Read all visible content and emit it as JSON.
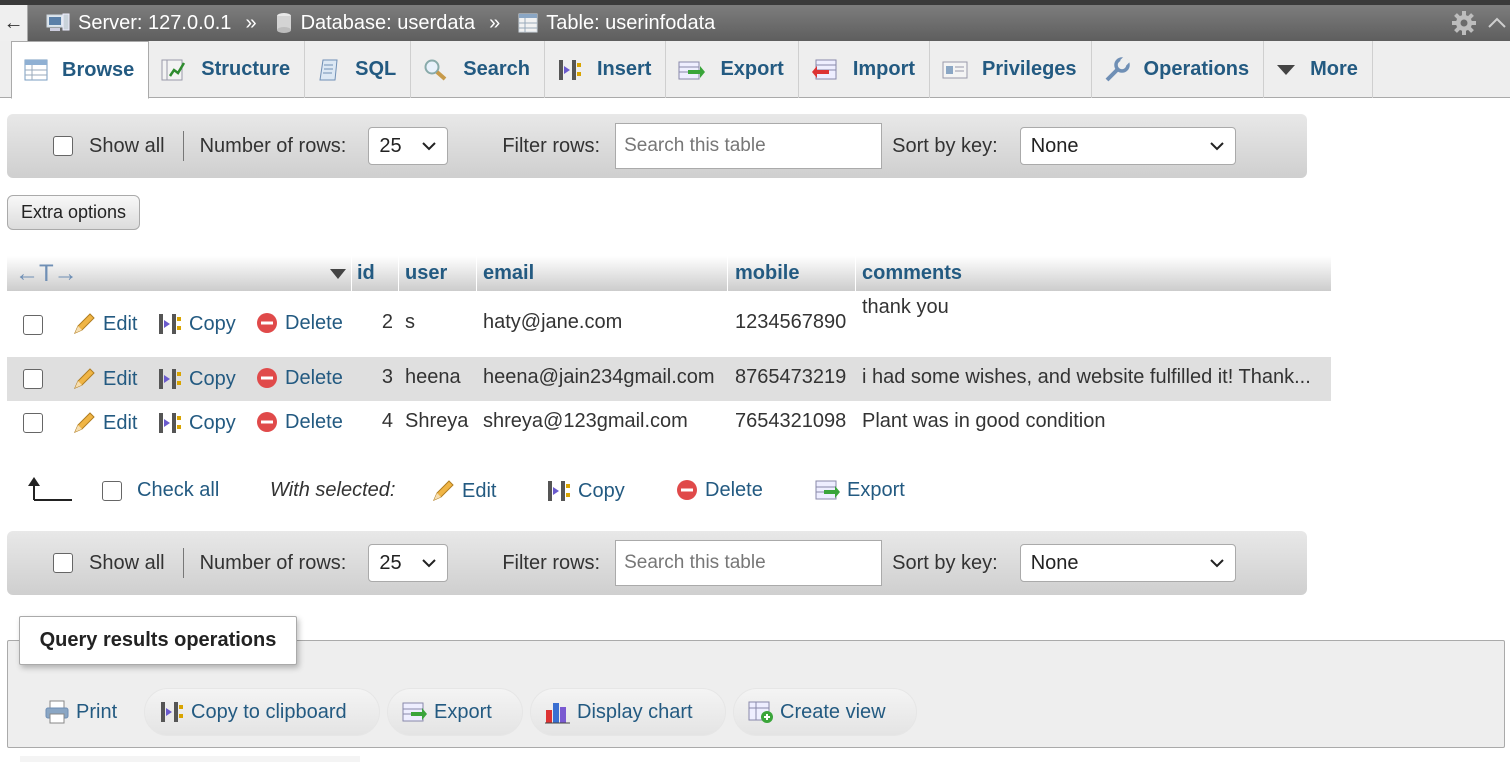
{
  "breadcrumb": {
    "back_glyph": "←",
    "server": "Server: 127.0.0.1",
    "database": "Database: userdata",
    "table": "Table: userinfodata",
    "separator": "»"
  },
  "tabs": [
    {
      "label": "Browse",
      "icon": "browse-icon",
      "active": true
    },
    {
      "label": "Structure",
      "icon": "structure-icon"
    },
    {
      "label": "SQL",
      "icon": "sql-icon"
    },
    {
      "label": "Search",
      "icon": "search-icon"
    },
    {
      "label": "Insert",
      "icon": "insert-icon"
    },
    {
      "label": "Export",
      "icon": "export-icon"
    },
    {
      "label": "Import",
      "icon": "import-icon"
    },
    {
      "label": "Privileges",
      "icon": "privileges-icon"
    },
    {
      "label": "Operations",
      "icon": "operations-icon"
    },
    {
      "label": "More",
      "icon": "more-icon"
    }
  ],
  "navbar": {
    "show_all": "Show all",
    "rows_label": "Number of rows:",
    "rows_value": "25",
    "filter_label": "Filter rows:",
    "filter_placeholder": "Search this table",
    "sort_label": "Sort by key:",
    "sort_value": "None"
  },
  "extra_options": "Extra options",
  "table": {
    "col_toggle": "←T→",
    "columns": [
      "id",
      "user",
      "email",
      "mobile",
      "comments"
    ],
    "actions": {
      "edit": "Edit",
      "copy": "Copy",
      "delete": "Delete"
    },
    "rows": [
      {
        "id": "2",
        "user": "s",
        "email": "haty@jane.com",
        "mobile": "1234567890",
        "comments": "thank you"
      },
      {
        "id": "3",
        "user": "heena",
        "email": "heena@jain234gmail.com",
        "mobile": "8765473219",
        "comments": "i had some wishes, and website fulfilled it! Thank..."
      },
      {
        "id": "4",
        "user": "Shreya",
        "email": "shreya@123gmail.com",
        "mobile": "7654321098",
        "comments": "Plant was in good condition"
      }
    ]
  },
  "with_selected": {
    "check_all": "Check all",
    "label": "With selected:",
    "edit": "Edit",
    "copy": "Copy",
    "delete": "Delete",
    "export": "Export"
  },
  "query_ops": {
    "title": "Query results operations",
    "buttons": [
      "Print",
      "Copy to clipboard",
      "Export",
      "Display chart",
      "Create view"
    ]
  },
  "colors": {
    "link": "#235a81",
    "delete": "#e04040",
    "edit": "#e8a33a"
  }
}
